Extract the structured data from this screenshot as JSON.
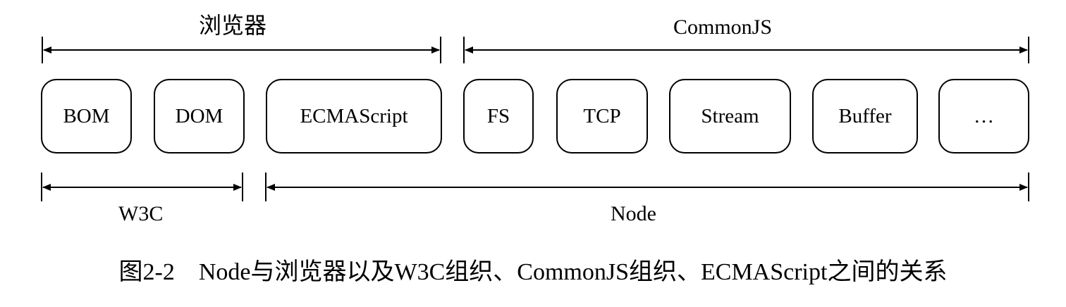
{
  "diagram": {
    "top_ranges": {
      "browser": "浏览器",
      "commonjs": "CommonJS"
    },
    "modules": [
      {
        "id": "bom",
        "label": "BOM"
      },
      {
        "id": "dom",
        "label": "DOM"
      },
      {
        "id": "ecmascript",
        "label": "ECMAScript"
      },
      {
        "id": "fs",
        "label": "FS"
      },
      {
        "id": "tcp",
        "label": "TCP"
      },
      {
        "id": "stream",
        "label": "Stream"
      },
      {
        "id": "buffer",
        "label": "Buffer"
      },
      {
        "id": "more",
        "label": "…"
      }
    ],
    "bottom_ranges": {
      "w3c": "W3C",
      "node": "Node"
    },
    "caption": "图2-2　Node与浏览器以及W3C组织、CommonJS组织、ECMAScript之间的关系"
  }
}
